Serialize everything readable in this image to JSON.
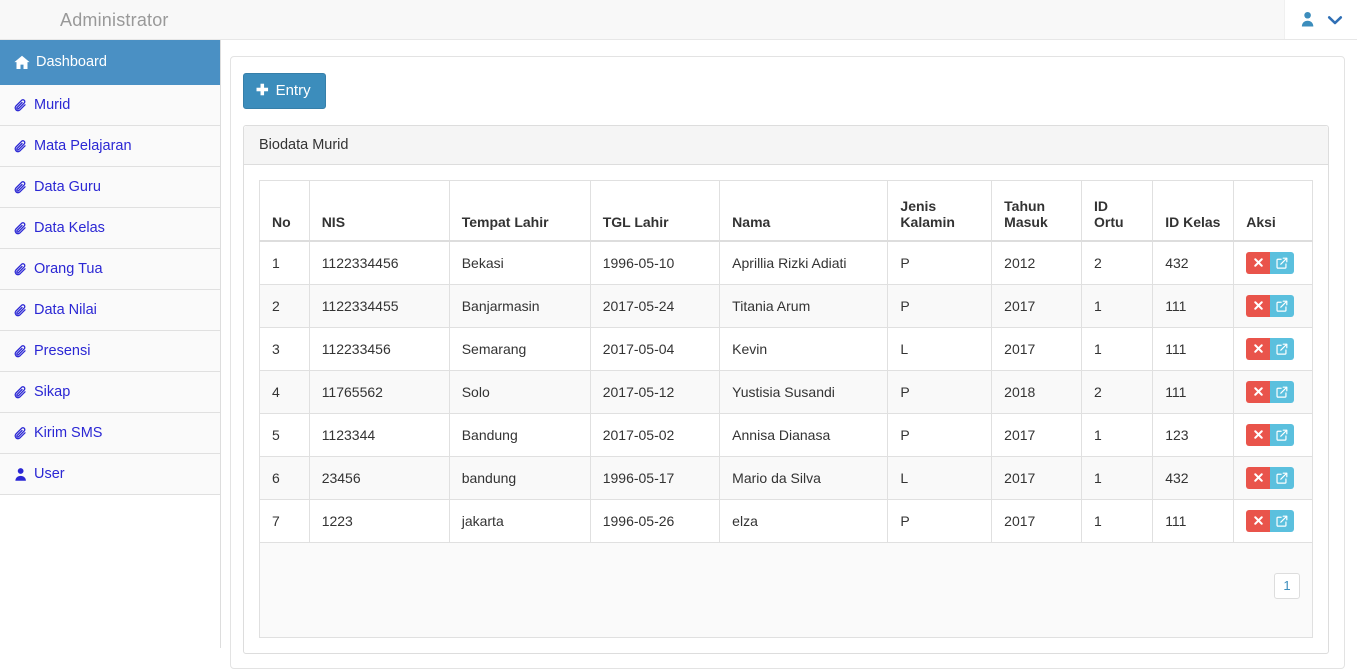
{
  "navbar": {
    "brand": "Administrator",
    "user_icon": "user-icon",
    "caret_icon": "chevron-down-icon"
  },
  "sidebar": {
    "items": [
      {
        "label": "Dashboard",
        "icon": "home-icon",
        "active": true
      },
      {
        "label": "Murid",
        "icon": "paperclip-icon",
        "active": false
      },
      {
        "label": "Mata Pelajaran",
        "icon": "paperclip-icon",
        "active": false
      },
      {
        "label": "Data Guru",
        "icon": "paperclip-icon",
        "active": false
      },
      {
        "label": "Data Kelas",
        "icon": "paperclip-icon",
        "active": false
      },
      {
        "label": "Orang Tua",
        "icon": "paperclip-icon",
        "active": false
      },
      {
        "label": "Data Nilai",
        "icon": "paperclip-icon",
        "active": false
      },
      {
        "label": "Presensi",
        "icon": "paperclip-icon",
        "active": false
      },
      {
        "label": "Sikap",
        "icon": "paperclip-icon",
        "active": false
      },
      {
        "label": "Kirim SMS",
        "icon": "paperclip-icon",
        "active": false
      },
      {
        "label": "User",
        "icon": "user-icon",
        "active": false
      }
    ]
  },
  "main": {
    "entry_button": "Entry",
    "entry_icon": "plus-icon",
    "panel_title": "Biodata Murid",
    "table": {
      "columns": [
        "No",
        "NIS",
        "Tempat Lahir",
        "TGL Lahir",
        "Nama",
        "Jenis Kalamin",
        "Tahun Masuk",
        "ID Ortu",
        "ID Kelas",
        "Aksi"
      ],
      "rows": [
        {
          "no": "1",
          "nis": "1122334456",
          "tempat": "Bekasi",
          "tgl": "1996-05-10",
          "nama": "Aprillia Rizki Adiati",
          "jk": "P",
          "tahun": "2012",
          "ortu": "2",
          "kelas": "432"
        },
        {
          "no": "2",
          "nis": "1122334455",
          "tempat": "Banjarmasin",
          "tgl": "2017-05-24",
          "nama": "Titania Arum",
          "jk": "P",
          "tahun": "2017",
          "ortu": "1",
          "kelas": "111"
        },
        {
          "no": "3",
          "nis": "112233456",
          "tempat": "Semarang",
          "tgl": "2017-05-04",
          "nama": "Kevin",
          "jk": "L",
          "tahun": "2017",
          "ortu": "1",
          "kelas": "111"
        },
        {
          "no": "4",
          "nis": "11765562",
          "tempat": "Solo",
          "tgl": "2017-05-12",
          "nama": "Yustisia Susandi",
          "jk": "P",
          "tahun": "2018",
          "ortu": "2",
          "kelas": "111"
        },
        {
          "no": "5",
          "nis": "1123344",
          "tempat": "Bandung",
          "tgl": "2017-05-02",
          "nama": "Annisa Dianasa",
          "jk": "P",
          "tahun": "2017",
          "ortu": "1",
          "kelas": "123"
        },
        {
          "no": "6",
          "nis": "23456",
          "tempat": "bandung",
          "tgl": "1996-05-17",
          "nama": "Mario da Silva",
          "jk": "L",
          "tahun": "2017",
          "ortu": "1",
          "kelas": "432"
        },
        {
          "no": "7",
          "nis": "1223",
          "tempat": "jakarta",
          "tgl": "1996-05-26",
          "nama": "elza",
          "jk": "P",
          "tahun": "2017",
          "ortu": "1",
          "kelas": "111"
        }
      ],
      "action_icons": {
        "delete": "x-icon",
        "edit": "pencil-square-icon"
      }
    },
    "pagination": {
      "pages": [
        "1"
      ]
    }
  },
  "colors": {
    "primary": "#3c8dbc",
    "sidebar_active": "#4a90c4",
    "link": "#2b27d4",
    "danger": "#e9544b",
    "info": "#5bc0de"
  }
}
